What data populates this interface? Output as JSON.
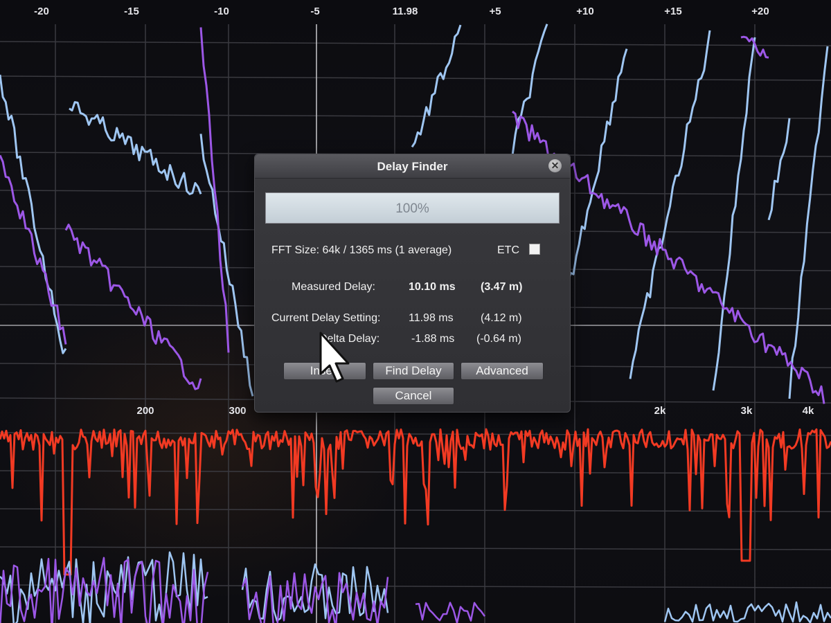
{
  "top_axis_labels": [
    "-20",
    "-15",
    "-10",
    "-5",
    "11.98",
    "+5",
    "+10",
    "+15",
    "+20"
  ],
  "freq_axis_labels": [
    "200",
    "300",
    "2k",
    "3k",
    "4k"
  ],
  "colors": {
    "trace_blue": "#9fc6f2",
    "trace_purple": "#9c57e6",
    "trace_red": "#f23a23",
    "grid": "#3a3a40"
  },
  "dialog": {
    "title": "Delay Finder",
    "close_icon": "close-icon",
    "progress_label": "100%",
    "progress_value": 1.0,
    "fft_info": "FFT Size: 64k / 1365 ms (1 average)",
    "etc_label": "ETC",
    "etc_checked": false,
    "measured_label": "Measured Delay:",
    "measured_ms": "10.10 ms",
    "measured_m": "(3.47 m)",
    "current_label": "Current Delay Setting:",
    "current_ms": "11.98 ms",
    "current_m": "(4.12 m)",
    "delta_label": "Delta Delay:",
    "delta_ms": "-1.88 ms",
    "delta_m": "(-0.64 m)",
    "insert_label": "Insert",
    "find_label": "Find Delay",
    "advanced_label": "Advanced",
    "cancel_label": "Cancel"
  }
}
